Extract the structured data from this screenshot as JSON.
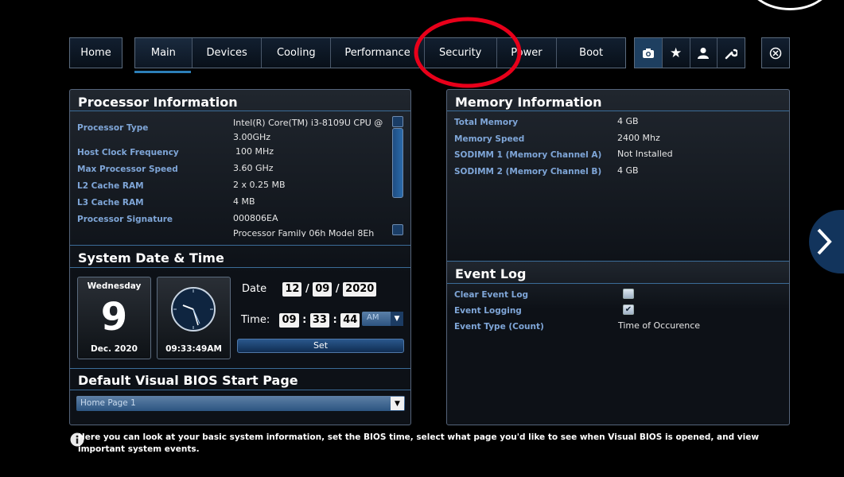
{
  "nav": {
    "home": "Home",
    "tabs": [
      "Main",
      "Devices",
      "Cooling",
      "Performance",
      "Security",
      "Power",
      "Boot"
    ],
    "active_tab": "Main",
    "icons": [
      "camera-icon",
      "star-icon",
      "user-icon",
      "wrench-icon"
    ],
    "close_icon": "close-icon"
  },
  "processor": {
    "title": "Processor Information",
    "rows": [
      {
        "label": "Processor Type",
        "value": "Intel(R) Core(TM) i3-8109U CPU @ 3.00GHz"
      },
      {
        "label": "Host Clock Frequency",
        "value": "100 MHz"
      },
      {
        "label": "Max Processor Speed",
        "value": "3.60 GHz"
      },
      {
        "label": "L2 Cache RAM",
        "value": "2 x 0.25 MB"
      },
      {
        "label": "L3 Cache RAM",
        "value": "4 MB"
      },
      {
        "label": "Processor Signature",
        "value": "000806EA"
      }
    ],
    "cutoff_text": "Processor Family 06h Model 8Eh"
  },
  "datetime": {
    "title": "System Date & Time",
    "weekday": "Wednesday",
    "day": "9",
    "month_year": "Dec. 2020",
    "clock_text": "09:33:49AM",
    "date_label": "Date",
    "date": {
      "month": "12",
      "day": "09",
      "year": "2020"
    },
    "time_label": "Time:",
    "time": {
      "hour": "09",
      "minute": "33",
      "second": "44",
      "ampm": "AM"
    },
    "set_label": "Set"
  },
  "startpage": {
    "title": "Default Visual BIOS Start Page",
    "selected": "Home Page 1"
  },
  "memory": {
    "title": "Memory Information",
    "rows": [
      {
        "label": "Total Memory",
        "value": "4 GB"
      },
      {
        "label": "Memory Speed",
        "value": "2400 Mhz"
      },
      {
        "label": "SODIMM 1 (Memory Channel A)",
        "value": "Not Installed"
      },
      {
        "label": "SODIMM 2 (Memory Channel B)",
        "value": "4 GB"
      }
    ]
  },
  "eventlog": {
    "title": "Event Log",
    "clear_label": "Clear Event Log",
    "clear_checked": false,
    "logging_label": "Event Logging",
    "logging_checked": true,
    "type_label": "Event Type (Count)",
    "type_value": "Time of Occurence"
  },
  "footer": {
    "text": "Here you can look at your basic system information, set the BIOS time, select what page you'd like to see when Visual BIOS is opened, and view important system events."
  },
  "colors": {
    "accent": "#2c7fb8",
    "label": "#7fa6d8",
    "highlight": "#e8001a"
  }
}
